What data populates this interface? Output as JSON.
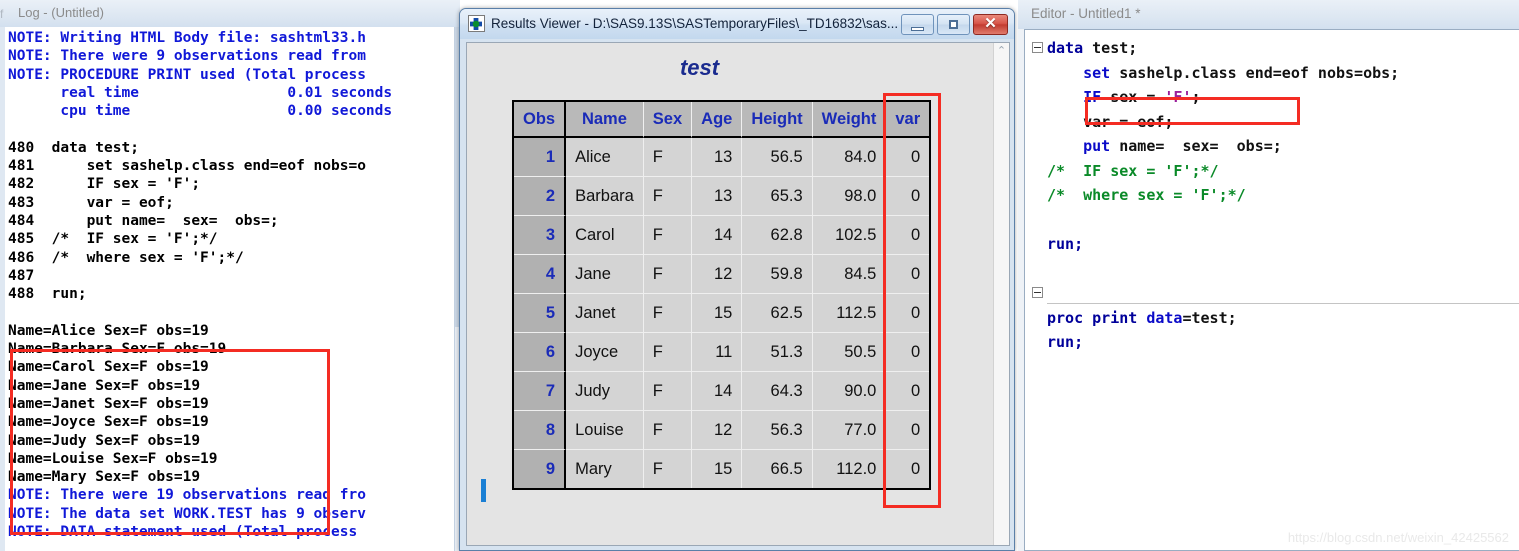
{
  "log_window": {
    "title": "Log - (Untitled)",
    "title_stub": "f",
    "lines": [
      {
        "text": "NOTE: Writing HTML Body file: sashtml33.h",
        "style": "note"
      },
      {
        "text": "NOTE: There were 9 observations read from",
        "style": "note"
      },
      {
        "text": "NOTE: PROCEDURE PRINT used (Total process",
        "style": "note"
      },
      {
        "text": "      real time                 0.01 seconds",
        "style": "note"
      },
      {
        "text": "      cpu time                  0.00 seconds",
        "style": "note"
      },
      {
        "text": "",
        "style": "blank"
      },
      {
        "text": "480  data test;",
        "style": "plain"
      },
      {
        "text": "481      set sashelp.class end=eof nobs=o",
        "style": "plain"
      },
      {
        "text": "482      IF sex = 'F';",
        "style": "plain"
      },
      {
        "text": "483      var = eof;",
        "style": "plain"
      },
      {
        "text": "484      put name=  sex=  obs=;",
        "style": "plain"
      },
      {
        "text": "485  /*  IF sex = 'F';*/",
        "style": "plain"
      },
      {
        "text": "486  /*  where sex = 'F';*/",
        "style": "plain"
      },
      {
        "text": "487",
        "style": "plain"
      },
      {
        "text": "488  run;",
        "style": "plain"
      },
      {
        "text": "",
        "style": "blank"
      },
      {
        "text": "Name=Alice Sex=F obs=19",
        "style": "plain"
      },
      {
        "text": "Name=Barbara Sex=F obs=19",
        "style": "plain"
      },
      {
        "text": "Name=Carol Sex=F obs=19",
        "style": "plain"
      },
      {
        "text": "Name=Jane Sex=F obs=19",
        "style": "plain"
      },
      {
        "text": "Name=Janet Sex=F obs=19",
        "style": "plain"
      },
      {
        "text": "Name=Joyce Sex=F obs=19",
        "style": "plain"
      },
      {
        "text": "Name=Judy Sex=F obs=19",
        "style": "plain"
      },
      {
        "text": "Name=Louise Sex=F obs=19",
        "style": "plain"
      },
      {
        "text": "Name=Mary Sex=F obs=19",
        "style": "plain"
      },
      {
        "text": "NOTE: There were 19 observations read fro",
        "style": "note"
      },
      {
        "text": "NOTE: The data set WORK.TEST has 9 observ",
        "style": "note"
      },
      {
        "text": "NOTE: DATA statement used (Total process",
        "style": "note"
      }
    ],
    "highlight_note": "red box around the PUT statement output lines"
  },
  "results_window": {
    "title": "Results Viewer - D:\\SAS9.13S\\SASTemporaryFiles\\_TD16832\\sas...",
    "app_icon": "sas-results-icon",
    "buttons": {
      "minimize": "minimize-button",
      "maximize": "maximize-button",
      "close_glyph": "✕"
    },
    "scroll_up_glyph": "⌃",
    "report_title": "test",
    "table": {
      "columns": [
        "Obs",
        "Name",
        "Sex",
        "Age",
        "Height",
        "Weight",
        "var"
      ],
      "rows": [
        {
          "obs": "1",
          "name": "Alice",
          "sex": "F",
          "age": "13",
          "height": "56.5",
          "weight": "84.0",
          "var": "0"
        },
        {
          "obs": "2",
          "name": "Barbara",
          "sex": "F",
          "age": "13",
          "height": "65.3",
          "weight": "98.0",
          "var": "0"
        },
        {
          "obs": "3",
          "name": "Carol",
          "sex": "F",
          "age": "14",
          "height": "62.8",
          "weight": "102.5",
          "var": "0"
        },
        {
          "obs": "4",
          "name": "Jane",
          "sex": "F",
          "age": "12",
          "height": "59.8",
          "weight": "84.5",
          "var": "0"
        },
        {
          "obs": "5",
          "name": "Janet",
          "sex": "F",
          "age": "15",
          "height": "62.5",
          "weight": "112.5",
          "var": "0"
        },
        {
          "obs": "6",
          "name": "Joyce",
          "sex": "F",
          "age": "11",
          "height": "51.3",
          "weight": "50.5",
          "var": "0"
        },
        {
          "obs": "7",
          "name": "Judy",
          "sex": "F",
          "age": "14",
          "height": "64.3",
          "weight": "90.0",
          "var": "0"
        },
        {
          "obs": "8",
          "name": "Louise",
          "sex": "F",
          "age": "12",
          "height": "56.3",
          "weight": "77.0",
          "var": "0"
        },
        {
          "obs": "9",
          "name": "Mary",
          "sex": "F",
          "age": "15",
          "height": "66.5",
          "weight": "112.0",
          "var": "0"
        }
      ]
    }
  },
  "editor_window": {
    "title": "Editor - Untitled1 *",
    "code_lines": [
      [
        {
          "t": "data",
          "c": "kw-darkblue"
        },
        {
          "t": " test;",
          "c": "kw-black"
        }
      ],
      [
        {
          "t": "    ",
          "c": "kw-black"
        },
        {
          "t": "set",
          "c": "kw-blue"
        },
        {
          "t": " sashelp.class end=eof nobs=obs;",
          "c": "kw-black"
        }
      ],
      [
        {
          "t": "    ",
          "c": "kw-black"
        },
        {
          "t": "IF",
          "c": "kw-blue"
        },
        {
          "t": " sex = ",
          "c": "kw-black"
        },
        {
          "t": "'F'",
          "c": "kw-purple"
        },
        {
          "t": ";",
          "c": "kw-black"
        }
      ],
      [
        {
          "t": "    var = eof;",
          "c": "kw-black"
        }
      ],
      [
        {
          "t": "    ",
          "c": "kw-black"
        },
        {
          "t": "put",
          "c": "kw-blue"
        },
        {
          "t": " name=  sex=  obs=;",
          "c": "kw-black"
        }
      ],
      [
        {
          "t": "/*  IF sex = 'F';*/",
          "c": "kw-green"
        }
      ],
      [
        {
          "t": "/*  where sex = 'F';*/",
          "c": "kw-green"
        }
      ],
      [
        {
          "t": "",
          "c": "kw-black"
        }
      ],
      [
        {
          "t": "run;",
          "c": "kw-darkblue"
        }
      ],
      [
        {
          "t": "",
          "c": "kw-black"
        }
      ],
      [
        {
          "t": "",
          "c": "kw-black"
        }
      ],
      [
        {
          "t": "proc print ",
          "c": "kw-darkblue"
        },
        {
          "t": "data",
          "c": "kw-blue"
        },
        {
          "t": "=test;",
          "c": "kw-black"
        }
      ],
      [
        {
          "t": "run;",
          "c": "kw-darkblue"
        }
      ]
    ],
    "fold_markers": [
      "fold-data-block",
      "fold-proc-block"
    ]
  },
  "watermark": "https://blog.csdn.net/weixin_42425562",
  "colors": {
    "log_note_blue": "#1018d8",
    "annotation_red": "#f42c23",
    "sas_header_blue": "#1a2bb8",
    "title_italic_blue": "#1a2b8f",
    "editor_keyword_blue": "#0a0ac8",
    "editor_comment_green": "#0a8a28",
    "editor_string_purple": "#9b1f9b"
  }
}
